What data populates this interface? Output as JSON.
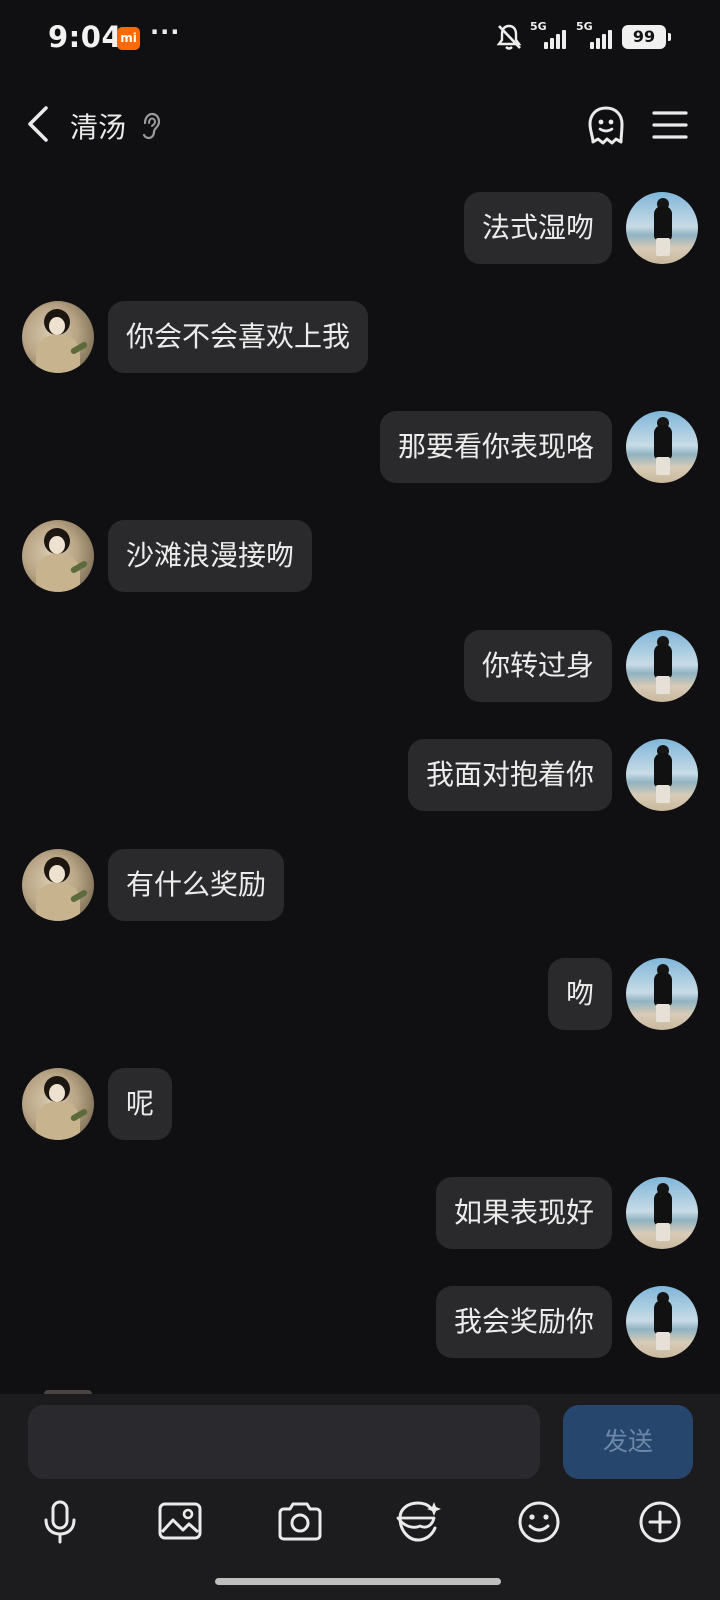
{
  "status_bar": {
    "time": "9:04",
    "brand_badge": "mi",
    "more_dots": "···",
    "signal1_label": "5G",
    "signal2_label": "5G",
    "battery": "99"
  },
  "header": {
    "title": "清汤",
    "icons": [
      "back-icon",
      "ear-icon",
      "ghost-icon",
      "menu-icon"
    ]
  },
  "messages": [
    {
      "sender": "me",
      "text": "法式湿吻"
    },
    {
      "sender": "her",
      "text": "你会不会喜欢上我"
    },
    {
      "sender": "me",
      "text": "那要看你表现咯"
    },
    {
      "sender": "her",
      "text": "沙滩浪漫接吻"
    },
    {
      "sender": "me",
      "text": "你转过身"
    },
    {
      "sender": "me",
      "text": "我面对抱着你"
    },
    {
      "sender": "her",
      "text": "有什么奖励"
    },
    {
      "sender": "me",
      "text": "吻"
    },
    {
      "sender": "her",
      "text": "呢"
    },
    {
      "sender": "me",
      "text": "如果表现好"
    },
    {
      "sender": "me",
      "text": "我会奖励你"
    }
  ],
  "composer": {
    "input_value": "",
    "send_label": "发送"
  },
  "toolbar": {
    "items": [
      "microphone-icon",
      "image-icon",
      "camera-icon",
      "sticker-icon",
      "emoji-icon",
      "plus-icon"
    ]
  },
  "colors": {
    "background": "#101012",
    "bubble": "#2a2a2d",
    "send_button": "#27466d",
    "brand_badge": "#ff6a00"
  }
}
